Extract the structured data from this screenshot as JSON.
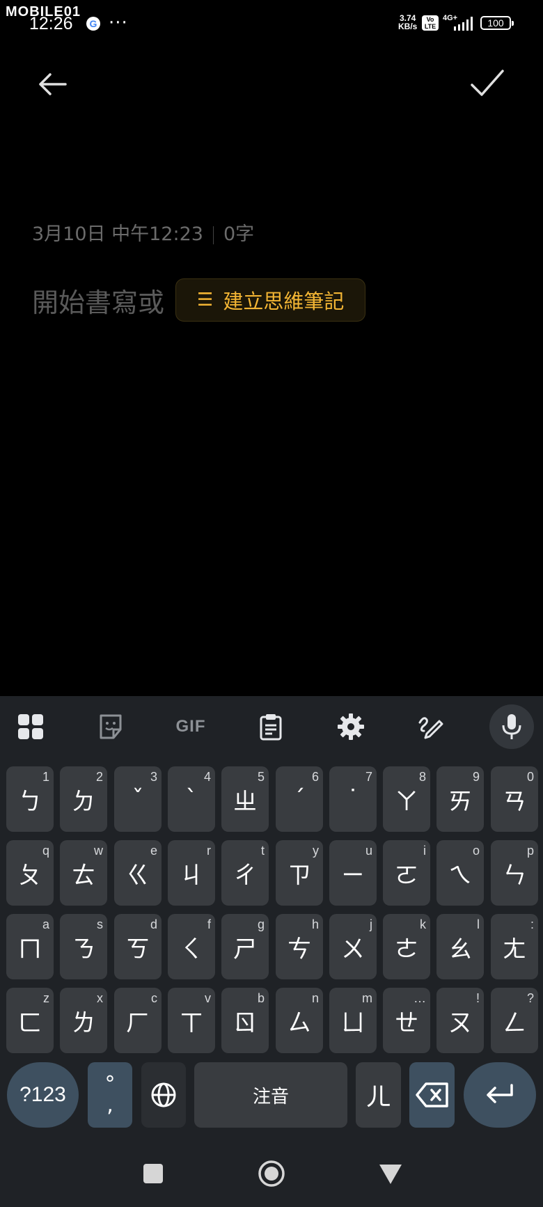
{
  "status": {
    "brand": "MOBILE01",
    "time": "12:26",
    "google_badge": "G",
    "more": "···",
    "net_speed_value": "3.74",
    "net_speed_unit": "KB/s",
    "volte": "Vo LTE",
    "network": "4G+",
    "battery": "100"
  },
  "editor": {
    "date": "3月10日 中午12:23",
    "char_count": "0字",
    "placeholder": "開始書寫或",
    "mindmap_label": "建立思維筆記",
    "mindmap_icon": "☰"
  },
  "toolbar": {
    "items": [
      "apps-grid-icon",
      "sticker-icon",
      "gif",
      "clipboard-icon",
      "settings-icon",
      "handwriting-icon",
      "mic-icon"
    ],
    "gif_label": "GIF"
  },
  "keys": {
    "row1": [
      {
        "char": "ㄅ",
        "hint": "1"
      },
      {
        "char": "ㄉ",
        "hint": "2"
      },
      {
        "char": "ˇ",
        "hint": "3"
      },
      {
        "char": "ˋ",
        "hint": "4"
      },
      {
        "char": "ㄓ",
        "hint": "5"
      },
      {
        "char": "ˊ",
        "hint": "6"
      },
      {
        "char": "˙",
        "hint": "7"
      },
      {
        "char": "ㄚ",
        "hint": "8"
      },
      {
        "char": "ㄞ",
        "hint": "9"
      },
      {
        "char": "ㄢ",
        "hint": "0"
      }
    ],
    "row2": [
      {
        "char": "ㄆ",
        "hint": "q"
      },
      {
        "char": "ㄊ",
        "hint": "w"
      },
      {
        "char": "ㄍ",
        "hint": "e"
      },
      {
        "char": "ㄐ",
        "hint": "r"
      },
      {
        "char": "ㄔ",
        "hint": "t"
      },
      {
        "char": "ㄗ",
        "hint": "y"
      },
      {
        "char": "ㄧ",
        "hint": "u"
      },
      {
        "char": "ㄛ",
        "hint": "i"
      },
      {
        "char": "ㄟ",
        "hint": "o"
      },
      {
        "char": "ㄣ",
        "hint": "p"
      }
    ],
    "row3": [
      {
        "char": "ㄇ",
        "hint": "a"
      },
      {
        "char": "ㄋ",
        "hint": "s"
      },
      {
        "char": "ㄎ",
        "hint": "d"
      },
      {
        "char": "ㄑ",
        "hint": "f"
      },
      {
        "char": "ㄕ",
        "hint": "g"
      },
      {
        "char": "ㄘ",
        "hint": "h"
      },
      {
        "char": "ㄨ",
        "hint": "j"
      },
      {
        "char": "ㄜ",
        "hint": "k"
      },
      {
        "char": "ㄠ",
        "hint": "l"
      },
      {
        "char": "ㄤ",
        "hint": ":"
      }
    ],
    "row4": [
      {
        "char": "ㄈ",
        "hint": "z"
      },
      {
        "char": "ㄌ",
        "hint": "x"
      },
      {
        "char": "ㄏ",
        "hint": "c"
      },
      {
        "char": "ㄒ",
        "hint": "v"
      },
      {
        "char": "ㄖ",
        "hint": "b"
      },
      {
        "char": "ㄙ",
        "hint": "n"
      },
      {
        "char": "ㄩ",
        "hint": "m"
      },
      {
        "char": "ㄝ",
        "hint": "…"
      },
      {
        "char": "ㄡ",
        "hint": "!"
      },
      {
        "char": "ㄥ",
        "hint": "?"
      }
    ],
    "bottom": {
      "symbols": "?123",
      "punct_top": "°",
      "punct_bottom": ",",
      "space": "注音",
      "er": "ㄦ"
    }
  }
}
